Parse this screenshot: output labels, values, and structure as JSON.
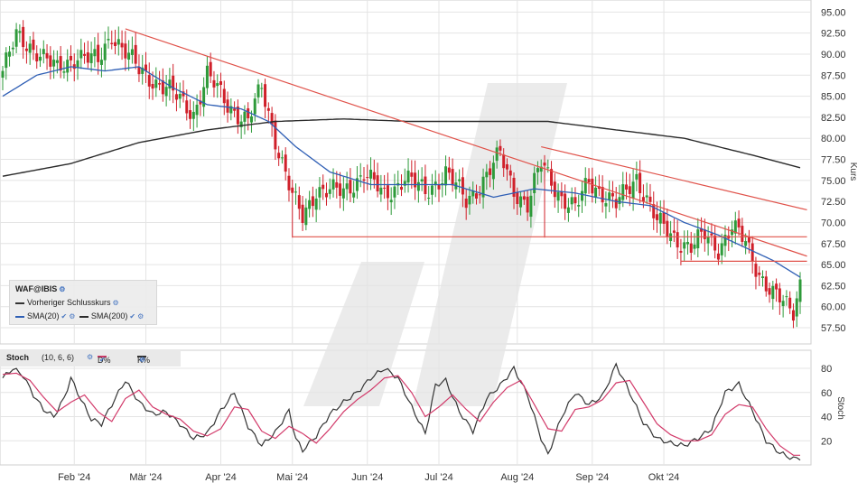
{
  "colors": {
    "up": "#2e9a3a",
    "down": "#d0202a",
    "sma20": "#2f5fb5",
    "sma200": "#2b2b2b",
    "trend": "#e0524a",
    "d_line": "#d23a6a",
    "k_line": "#333333",
    "grid": "#e4e4e4",
    "watermark": "#e6e6e6"
  },
  "legend": {
    "symbol": "WAF@IBIS",
    "prev_close": "Vorheriger Schlusskurs",
    "sma20": "SMA(20)",
    "sma200": "SMA(200)"
  },
  "stoch_header": {
    "title": "Stoch",
    "params": "(10, 6, 6)",
    "d_label": "D%",
    "k_label": "K%"
  },
  "chart_data": [
    {
      "type": "line",
      "chart_style": "candlestick",
      "y_axis_label": "Kurs",
      "ylim": [
        56.0,
        96.0
      ],
      "y_ticks": [
        "95.00",
        "92.50",
        "90.00",
        "87.50",
        "85.00",
        "82.50",
        "80.00",
        "77.50",
        "75.00",
        "72.50",
        "70.00",
        "67.50",
        "65.00",
        "62.50",
        "60.00",
        "57.50"
      ],
      "months": [
        "Feb '24",
        "Mär '24",
        "Apr '24",
        "Mai '24",
        "Jun '24",
        "Jul '24",
        "Aug '24",
        "Sep '24",
        "Okt '24"
      ],
      "anchors": [
        [
          0,
          88.0
        ],
        [
          4,
          92.0
        ],
        [
          10,
          90.5
        ],
        [
          16,
          88.0
        ],
        [
          22,
          90.0
        ],
        [
          28,
          89.0
        ],
        [
          32,
          92.5
        ],
        [
          40,
          88.0
        ],
        [
          48,
          86.0
        ],
        [
          56,
          83.0
        ],
        [
          60,
          87.5
        ],
        [
          66,
          84.0
        ],
        [
          72,
          82.0
        ],
        [
          76,
          86.0
        ],
        [
          80,
          80.0
        ],
        [
          85,
          73.0
        ],
        [
          88,
          70.5
        ],
        [
          92,
          74.0
        ],
        [
          100,
          73.5
        ],
        [
          106,
          76.0
        ],
        [
          112,
          73.0
        ],
        [
          118,
          75.5
        ],
        [
          124,
          73.5
        ],
        [
          130,
          76.0
        ],
        [
          136,
          72.5
        ],
        [
          140,
          74.5
        ],
        [
          146,
          78.0
        ],
        [
          150,
          74.0
        ],
        [
          154,
          72.0
        ],
        [
          158,
          77.0
        ],
        [
          164,
          73.0
        ],
        [
          168,
          71.5
        ],
        [
          172,
          75.0
        ],
        [
          176,
          73.5
        ],
        [
          180,
          72.0
        ],
        [
          186,
          75.5
        ],
        [
          192,
          70.0
        ],
        [
          198,
          68.0
        ],
        [
          202,
          67.0
        ],
        [
          206,
          68.5
        ],
        [
          210,
          67.0
        ],
        [
          214,
          69.5
        ],
        [
          218,
          67.5
        ],
        [
          222,
          64.0
        ],
        [
          226,
          61.5
        ],
        [
          230,
          60.0
        ],
        [
          232,
          59.5
        ],
        [
          234,
          63.0
        ]
      ],
      "wick_extremes": [
        [
          85,
          68.2
        ],
        [
          159,
          68.2
        ],
        [
          233,
          58.7
        ]
      ],
      "sma20_anchors": [
        [
          0,
          85.0
        ],
        [
          10,
          87.5
        ],
        [
          20,
          88.5
        ],
        [
          30,
          88.0
        ],
        [
          40,
          88.5
        ],
        [
          50,
          86.0
        ],
        [
          60,
          84.0
        ],
        [
          70,
          83.5
        ],
        [
          78,
          82.0
        ],
        [
          86,
          79.0
        ],
        [
          96,
          76.0
        ],
        [
          108,
          74.5
        ],
        [
          120,
          74.5
        ],
        [
          132,
          74.5
        ],
        [
          144,
          73.0
        ],
        [
          156,
          74.0
        ],
        [
          168,
          73.5
        ],
        [
          180,
          72.5
        ],
        [
          190,
          72.0
        ],
        [
          200,
          70.0
        ],
        [
          210,
          68.5
        ],
        [
          218,
          67.0
        ],
        [
          226,
          65.5
        ],
        [
          234,
          63.5
        ]
      ],
      "sma200_anchors": [
        [
          0,
          75.5
        ],
        [
          20,
          77.0
        ],
        [
          40,
          79.5
        ],
        [
          60,
          81.0
        ],
        [
          80,
          82.0
        ],
        [
          100,
          82.3
        ],
        [
          120,
          82.0
        ],
        [
          140,
          82.0
        ],
        [
          160,
          82.0
        ],
        [
          180,
          81.0
        ],
        [
          200,
          80.0
        ],
        [
          220,
          78.0
        ],
        [
          234,
          76.5
        ]
      ],
      "trend_lines": [
        {
          "x": [
            36,
            236
          ],
          "y": [
            93.0,
            66.0
          ]
        },
        {
          "x": [
            158,
            236
          ],
          "y": [
            79.0,
            71.5
          ]
        },
        {
          "x": [
            85,
            236
          ],
          "y": [
            68.3,
            68.3
          ]
        },
        {
          "x": [
            199,
            236
          ],
          "y": [
            65.4,
            65.4
          ]
        }
      ],
      "n_sessions": 235,
      "month_start_index": [
        21,
        42,
        64,
        85,
        107,
        128,
        151,
        173,
        194
      ]
    },
    {
      "type": "line",
      "title": "Stoch",
      "y_axis_label": "Stoch",
      "ylim": [
        0,
        95
      ],
      "y_ticks": [
        "80",
        "60",
        "40",
        "20"
      ],
      "series": [
        {
          "name": "K%",
          "anchors": [
            [
              0,
              72
            ],
            [
              3,
              80
            ],
            [
              6,
              74
            ],
            [
              9,
              58
            ],
            [
              12,
              46
            ],
            [
              15,
              40
            ],
            [
              18,
              55
            ],
            [
              20,
              72
            ],
            [
              23,
              54
            ],
            [
              26,
              38
            ],
            [
              29,
              34
            ],
            [
              32,
              50
            ],
            [
              36,
              70
            ],
            [
              40,
              52
            ],
            [
              44,
              42
            ],
            [
              48,
              44
            ],
            [
              52,
              34
            ],
            [
              56,
              22
            ],
            [
              60,
              26
            ],
            [
              64,
              45
            ],
            [
              68,
              60
            ],
            [
              72,
              32
            ],
            [
              76,
              16
            ],
            [
              80,
              27
            ],
            [
              84,
              45
            ],
            [
              86,
              22
            ],
            [
              88,
              12
            ],
            [
              92,
              24
            ],
            [
              96,
              42
            ],
            [
              100,
              52
            ],
            [
              104,
              60
            ],
            [
              108,
              72
            ],
            [
              112,
              80
            ],
            [
              116,
              72
            ],
            [
              120,
              48
            ],
            [
              124,
              26
            ],
            [
              127,
              66
            ],
            [
              130,
              70
            ],
            [
              134,
              44
            ],
            [
              138,
              28
            ],
            [
              142,
              55
            ],
            [
              146,
              66
            ],
            [
              150,
              80
            ],
            [
              154,
              58
            ],
            [
              158,
              22
            ],
            [
              160,
              8
            ],
            [
              164,
              40
            ],
            [
              168,
              60
            ],
            [
              172,
              50
            ],
            [
              176,
              57
            ],
            [
              180,
              83
            ],
            [
              184,
              60
            ],
            [
              188,
              35
            ],
            [
              192,
              22
            ],
            [
              196,
              18
            ],
            [
              200,
              16
            ],
            [
              204,
              22
            ],
            [
              208,
              30
            ],
            [
              212,
              60
            ],
            [
              216,
              67
            ],
            [
              220,
              45
            ],
            [
              224,
              20
            ],
            [
              228,
              10
            ],
            [
              232,
              5
            ],
            [
              234,
              6
            ]
          ]
        },
        {
          "name": "D%",
          "anchors": [
            [
              0,
              75
            ],
            [
              4,
              76
            ],
            [
              8,
              70
            ],
            [
              12,
              56
            ],
            [
              16,
              44
            ],
            [
              20,
              52
            ],
            [
              24,
              58
            ],
            [
              28,
              44
            ],
            [
              32,
              36
            ],
            [
              36,
              55
            ],
            [
              40,
              62
            ],
            [
              44,
              48
            ],
            [
              48,
              42
            ],
            [
              52,
              38
            ],
            [
              56,
              28
            ],
            [
              60,
              24
            ],
            [
              64,
              30
            ],
            [
              68,
              48
            ],
            [
              72,
              46
            ],
            [
              76,
              28
            ],
            [
              80,
              22
            ],
            [
              84,
              32
            ],
            [
              88,
              26
            ],
            [
              92,
              18
            ],
            [
              96,
              30
            ],
            [
              100,
              44
            ],
            [
              104,
              54
            ],
            [
              108,
              62
            ],
            [
              112,
              72
            ],
            [
              116,
              74
            ],
            [
              120,
              60
            ],
            [
              124,
              40
            ],
            [
              128,
              48
            ],
            [
              132,
              58
            ],
            [
              136,
              46
            ],
            [
              140,
              36
            ],
            [
              144,
              52
            ],
            [
              148,
              64
            ],
            [
              152,
              70
            ],
            [
              156,
              50
            ],
            [
              160,
              30
            ],
            [
              164,
              28
            ],
            [
              168,
              46
            ],
            [
              172,
              48
            ],
            [
              176,
              54
            ],
            [
              180,
              68
            ],
            [
              184,
              70
            ],
            [
              188,
              52
            ],
            [
              192,
              34
            ],
            [
              196,
              25
            ],
            [
              200,
              20
            ],
            [
              204,
              20
            ],
            [
              208,
              25
            ],
            [
              212,
              42
            ],
            [
              216,
              50
            ],
            [
              220,
              48
            ],
            [
              224,
              30
            ],
            [
              228,
              16
            ],
            [
              232,
              8
            ],
            [
              234,
              8
            ]
          ]
        }
      ]
    }
  ]
}
